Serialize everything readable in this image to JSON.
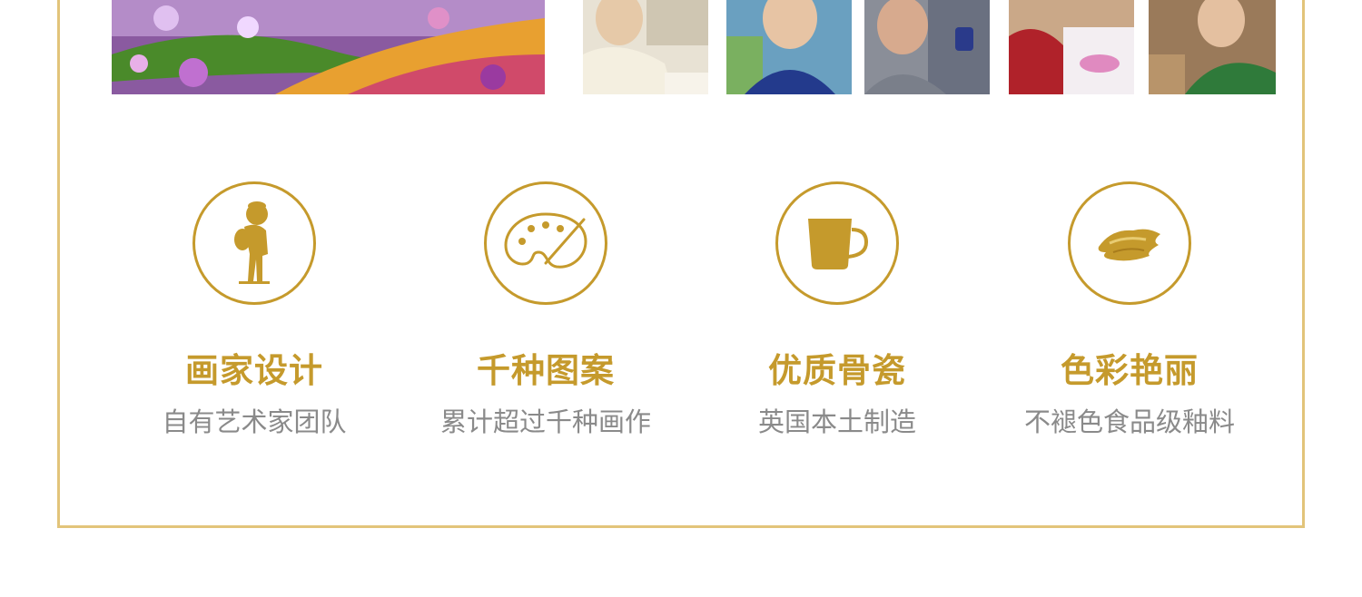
{
  "colors": {
    "gold": "#c59a2c",
    "frame_border": "#e2c47a",
    "subtitle_gray": "#8a8a8a"
  },
  "features": [
    {
      "icon": "artist-figure-icon",
      "title": "画家设计",
      "subtitle": "自有艺术家团队"
    },
    {
      "icon": "palette-icon",
      "title": "千种图案",
      "subtitle": "累计超过千种画作"
    },
    {
      "icon": "mug-icon",
      "title": "优质骨瓷",
      "subtitle": "英国本土制造"
    },
    {
      "icon": "paint-stroke-icon",
      "title": "色彩艳丽",
      "subtitle": "不褪色食品级釉料"
    }
  ]
}
